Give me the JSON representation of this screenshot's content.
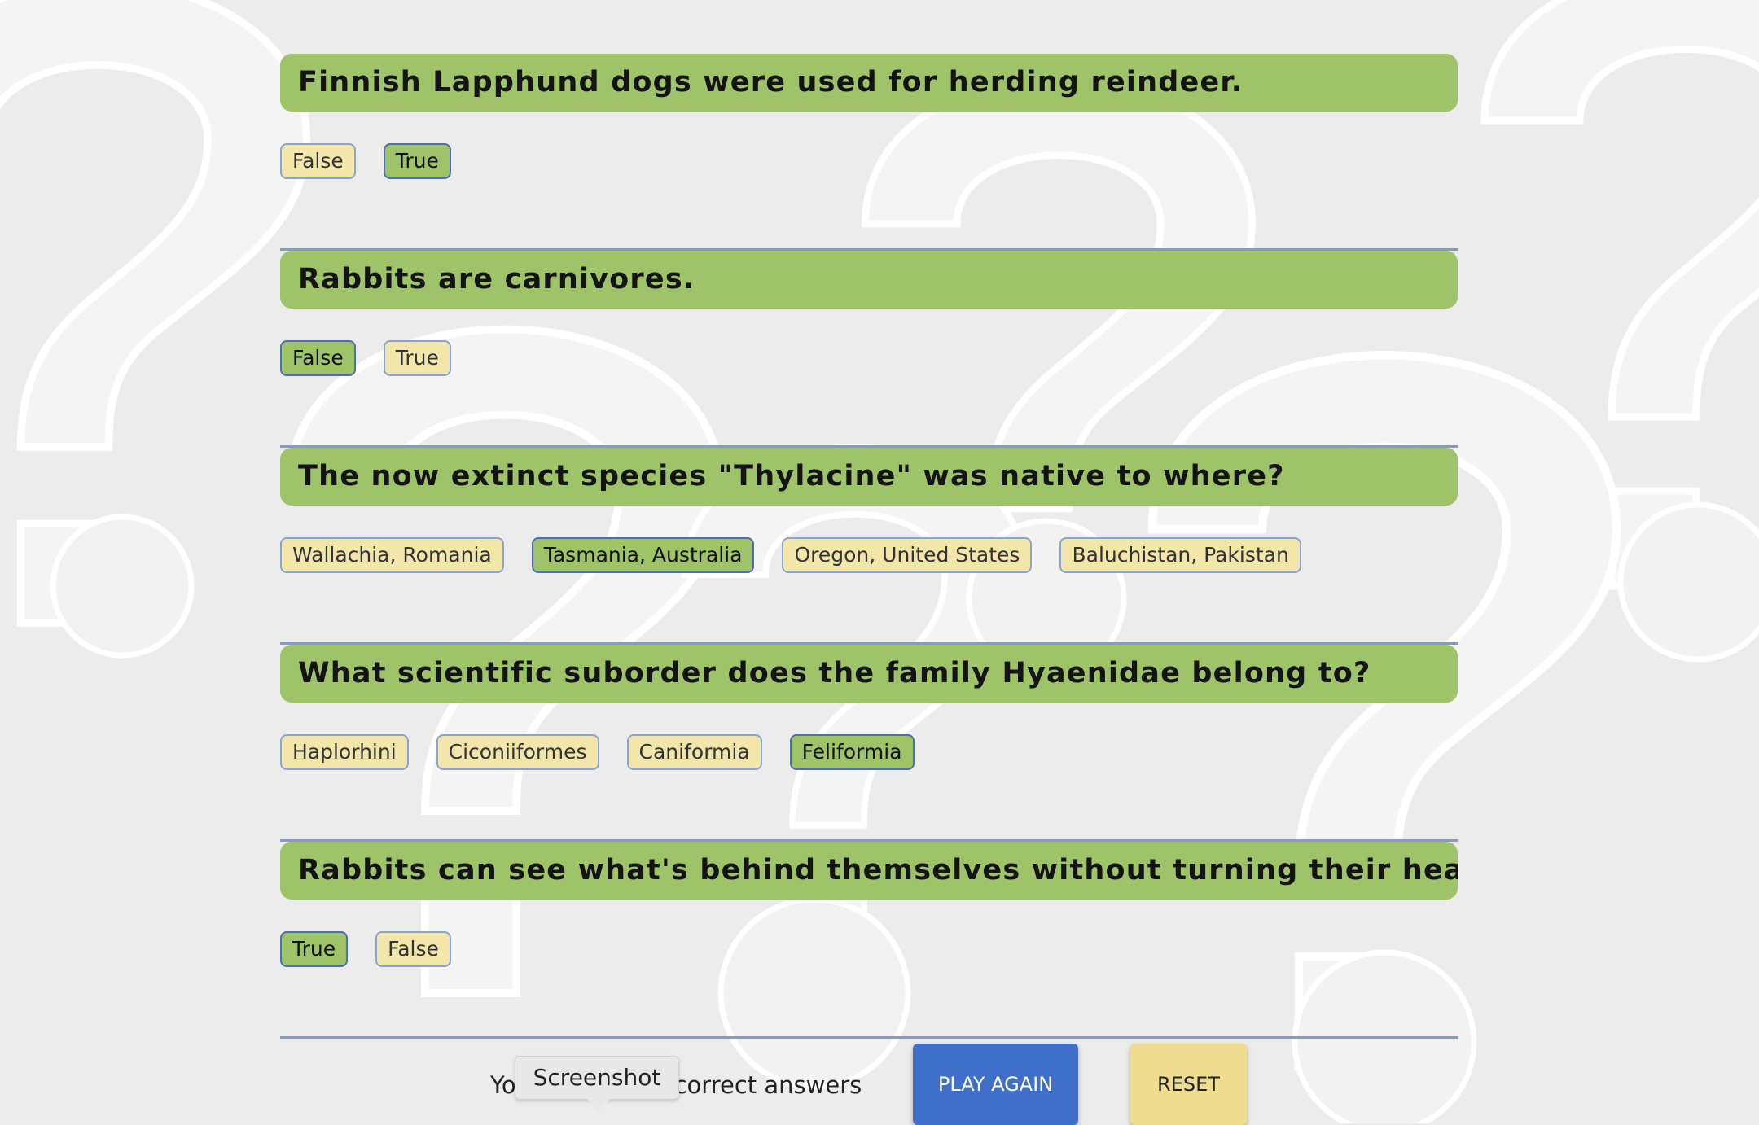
{
  "questions": [
    {
      "text": "Finnish Lapphund dogs were used for herding reindeer.",
      "answers": [
        "False",
        "True"
      ],
      "selected": 1
    },
    {
      "text": "Rabbits are carnivores.",
      "answers": [
        "False",
        "True"
      ],
      "selected": 0
    },
    {
      "text": "The now extinct species \"Thylacine\" was native to where?",
      "answers": [
        "Wallachia, Romania",
        "Tasmania, Australia",
        "Oregon, United States",
        "Baluchistan, Pakistan"
      ],
      "selected": 1
    },
    {
      "text": "What scientific suborder does the family Hyaenidae belong to?",
      "answers": [
        "Haplorhini",
        "Ciconiiformes",
        "Caniformia",
        "Feliformia"
      ],
      "selected": 3
    },
    {
      "text": "Rabbits can see what's behind themselves without turning their heads.",
      "answers": [
        "True",
        "False"
      ],
      "selected": 0
    }
  ],
  "footer": {
    "score_left": "Yo",
    "score_right": "correct answers",
    "tooltip": "Screenshot",
    "play_again": "PLAY AGAIN",
    "reset": "RESET"
  },
  "colors": {
    "title_bg": "#9ec368",
    "answer_bg": "#f2e6ab",
    "answer_selected_bg": "#9ec368",
    "divider": "#7f9cd0",
    "play_again_bg": "#3f6fc9",
    "reset_bg": "#eedd8e"
  },
  "background_icon": "question-mark-pattern"
}
